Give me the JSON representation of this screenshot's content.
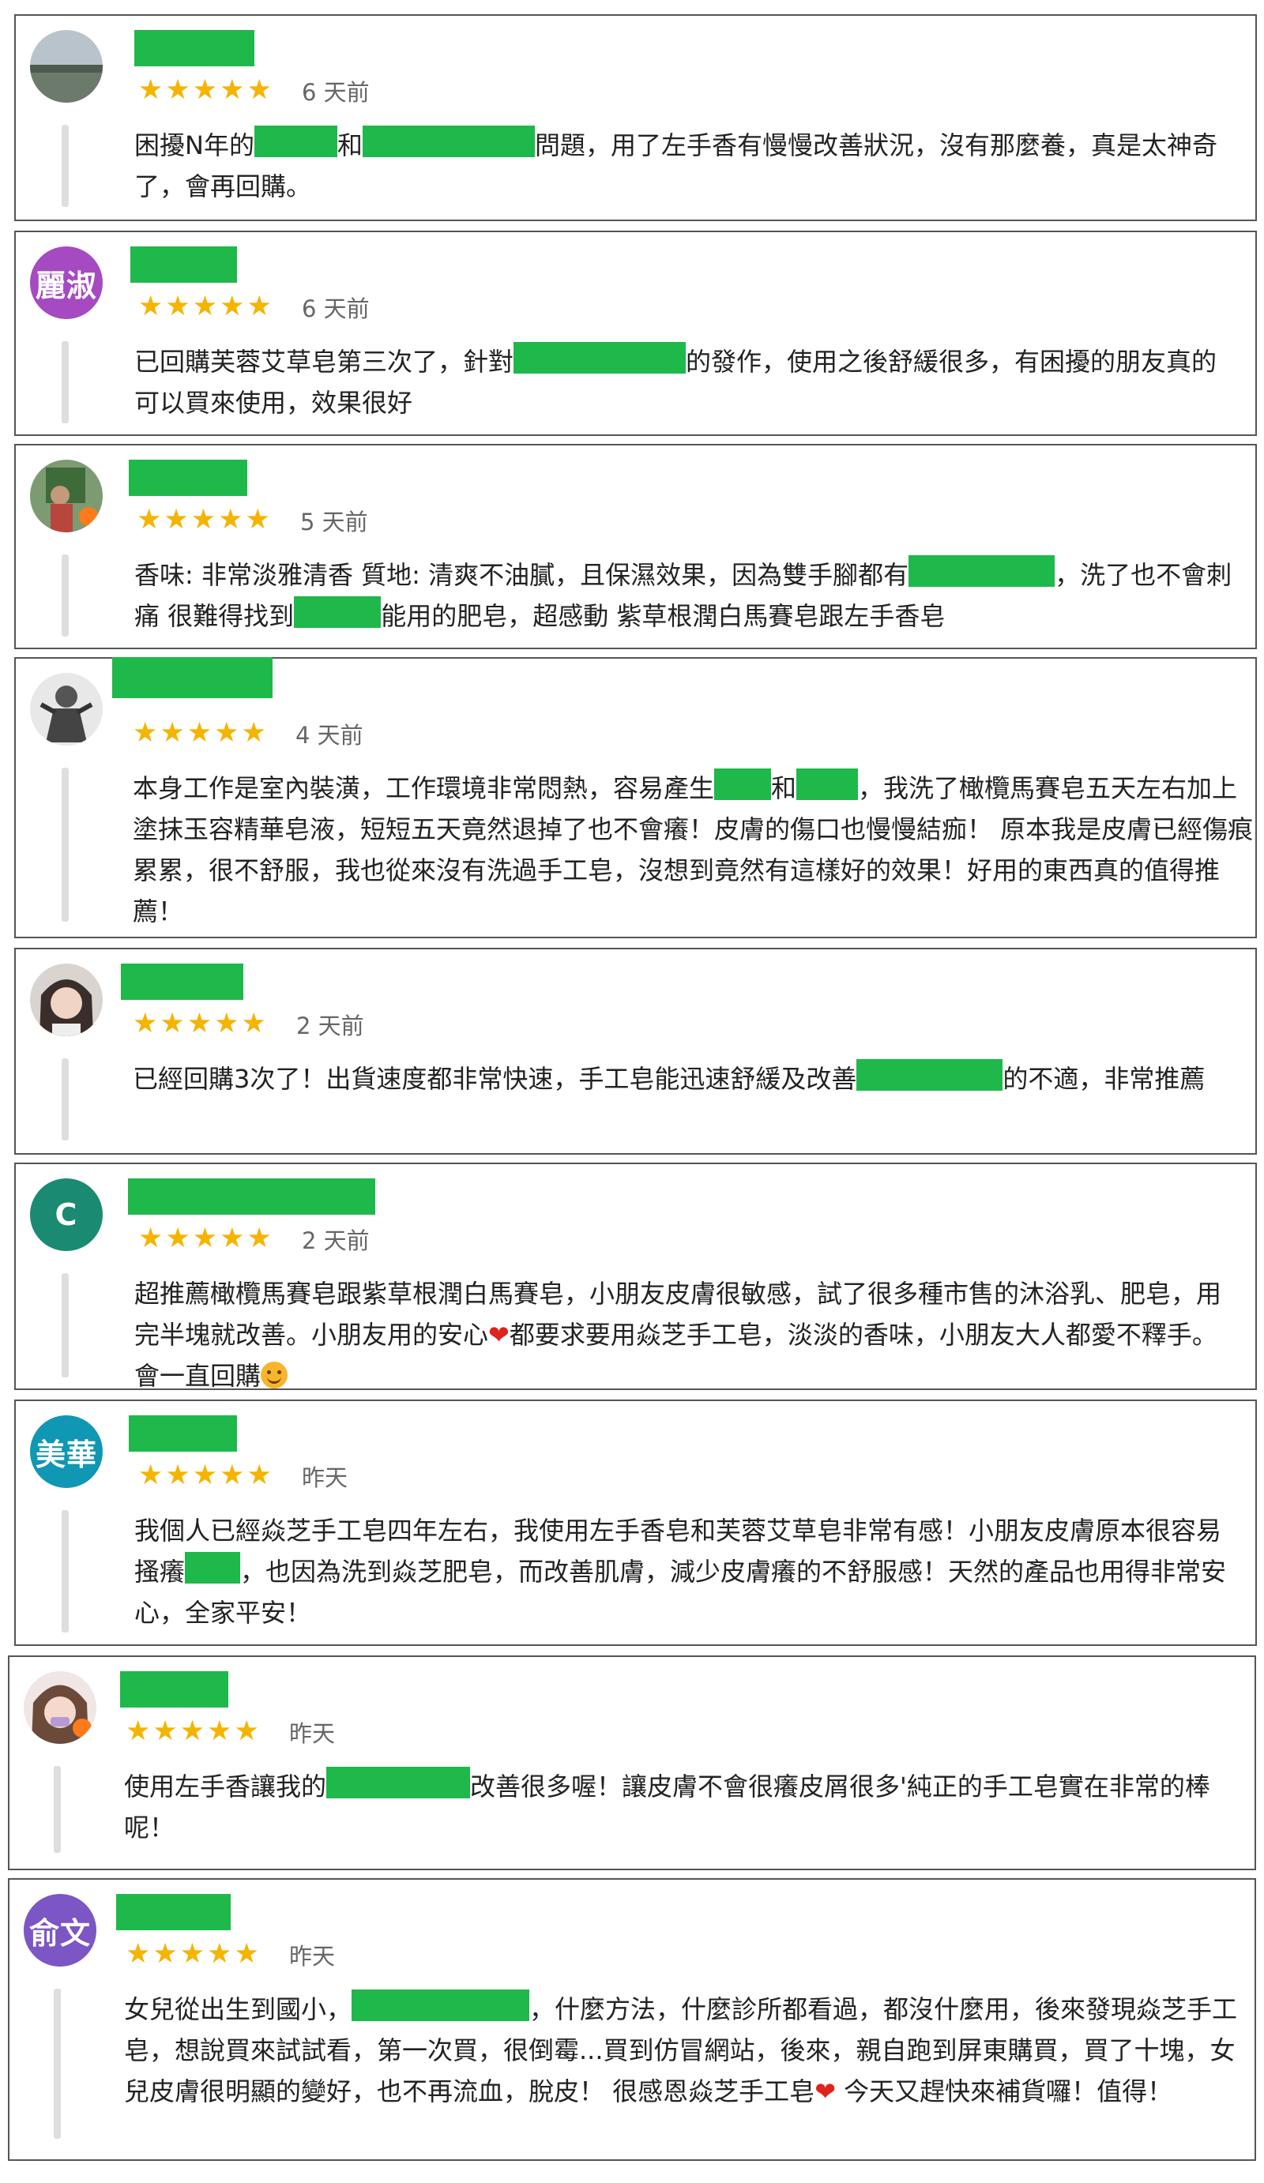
{
  "stars": "★★★★★",
  "colors": {
    "redaction": "#1fb84a",
    "star": "#f4b400",
    "heart": "#e0221c",
    "border": "#555555"
  },
  "reviews": [
    {
      "avatar_text": "",
      "time": "6 天前",
      "text": {
        "p1": "困擾N年的",
        "p2": "和",
        "p3": "問題，用了左手香有慢慢改善狀況，沒有那麼養，真是太神奇了，會再回購。"
      }
    },
    {
      "avatar_text": "麗淑",
      "avatar_color": "#a54ac1",
      "time": "6 天前",
      "text": {
        "p1": "已回購芙蓉艾草皂第三次了，針對",
        "p2": "的發作，使用之後舒緩很多，有困擾的朋友真的可以買來使用，效果很好"
      }
    },
    {
      "avatar_text": "",
      "time": "5 天前",
      "text": {
        "p1": "香味: 非常淡雅清香 質地: 清爽不油膩，且保濕效果，因為雙手腳都有",
        "p2": "，洗了也不會刺痛 很難得找到",
        "p3": "能用的肥皂，超感動 紫草根潤白馬賽皂跟左手香皂"
      }
    },
    {
      "avatar_text": "",
      "time": "4 天前",
      "text": {
        "p1": "本身工作是室內裝潢，工作環境非常悶熱，容易產生",
        "p2": "和",
        "p3": "，我洗了橄欖馬賽皂五天左右加上塗抹玉容精華皂液，短短五天竟然退掉了也不會癢！皮膚的傷口也慢慢結痂！ 原本我是皮膚已經傷痕累累，很不舒服，我也從來沒有洗過手工皂，沒想到竟然有這樣好的效果！好用的東西真的值得推薦！"
      }
    },
    {
      "avatar_text": "",
      "time": "2 天前",
      "text": {
        "p1": "已經回購3次了！出貨速度都非常快速，手工皂能迅速舒緩及改善",
        "p2": "的不適，非常推薦"
      }
    },
    {
      "avatar_text": "C",
      "avatar_color": "#1a8a72",
      "time": "2 天前",
      "text": {
        "p1": "超推薦橄欖馬賽皂跟紫草根潤白馬賽皂，小朋友皮膚很敏感，試了很多種市售的沐浴乳、肥皂，用完半塊就改善。小朋友用的安心",
        "heart": "❤",
        "p2": "都要求要用焱芝手工皂，淡淡的香味，小朋友大人都愛不釋手。會一直回購"
      }
    },
    {
      "avatar_text": "美華",
      "avatar_color": "#0f97b3",
      "time": "昨天",
      "text": {
        "p1": "我個人已經焱芝手工皂四年左右，我使用左手香皂和芙蓉艾草皂非常有感！小朋友皮膚原本很容易搔癢",
        "p2": "，也因為洗到焱芝肥皂，而改善肌膚，減少皮膚癢的不舒服感！天然的產品也用得非常安心，全家平安！"
      }
    },
    {
      "avatar_text": "",
      "time": "昨天",
      "text": {
        "p1": "使用左手香讓我的",
        "p2": "改善很多喔！讓皮膚不會很癢皮屑很多'純正的手工皂實在非常的棒呢！"
      }
    },
    {
      "avatar_text": "俞文",
      "avatar_color": "#7b56c4",
      "time": "昨天",
      "text": {
        "p1": "女兒從出生到國小，",
        "p2": "，什麼方法，什麼診所都看過，都沒什麼用，後來發現焱芝手工皂，想說買來試試看，第一次買，很倒霉...買到仿冒網站，後來，親自跑到屏東購買，買了十塊，女兒皮膚很明顯的變好，也不再流血，脫皮！ 很感恩焱芝手工皂",
        "heart": "❤",
        "p3": " 今天又趕快來補貨囉！值得！"
      }
    }
  ]
}
